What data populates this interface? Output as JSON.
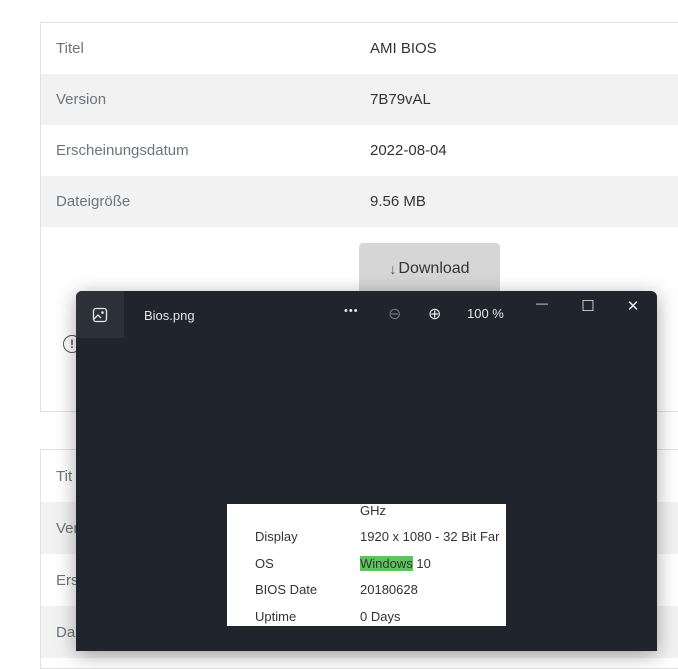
{
  "details": {
    "rows": [
      {
        "key": "Titel",
        "value": "AMI BIOS"
      },
      {
        "key": "Version",
        "value": "7B79vAL"
      },
      {
        "key": "Erscheinungsdatum",
        "value": "2022-08-04"
      },
      {
        "key": "Dateigröße",
        "value": "9.56 MB"
      }
    ],
    "download_arrow": "↓",
    "download_label": "Download"
  },
  "second_card": {
    "row_labels": [
      "Tit",
      "Ver",
      "Ers",
      "Da"
    ]
  },
  "viewer": {
    "file_name": "Bios.png",
    "more": "•••",
    "zoom_out": "⊖",
    "zoom_in": "⊕",
    "zoom_level": "100 %",
    "minimize": "—",
    "maximize": "☐",
    "close": "✕",
    "image": {
      "rows": [
        {
          "key": "",
          "value": "GHz"
        },
        {
          "key": "Display",
          "value": "1920 x 1080 - 32 Bit Far"
        },
        {
          "key": "OS",
          "value_highlight": "Windows",
          "value_rest": " 10"
        },
        {
          "key": "BIOS Date",
          "value": "20180628"
        },
        {
          "key": "Uptime",
          "value": "0 Days"
        }
      ]
    }
  }
}
